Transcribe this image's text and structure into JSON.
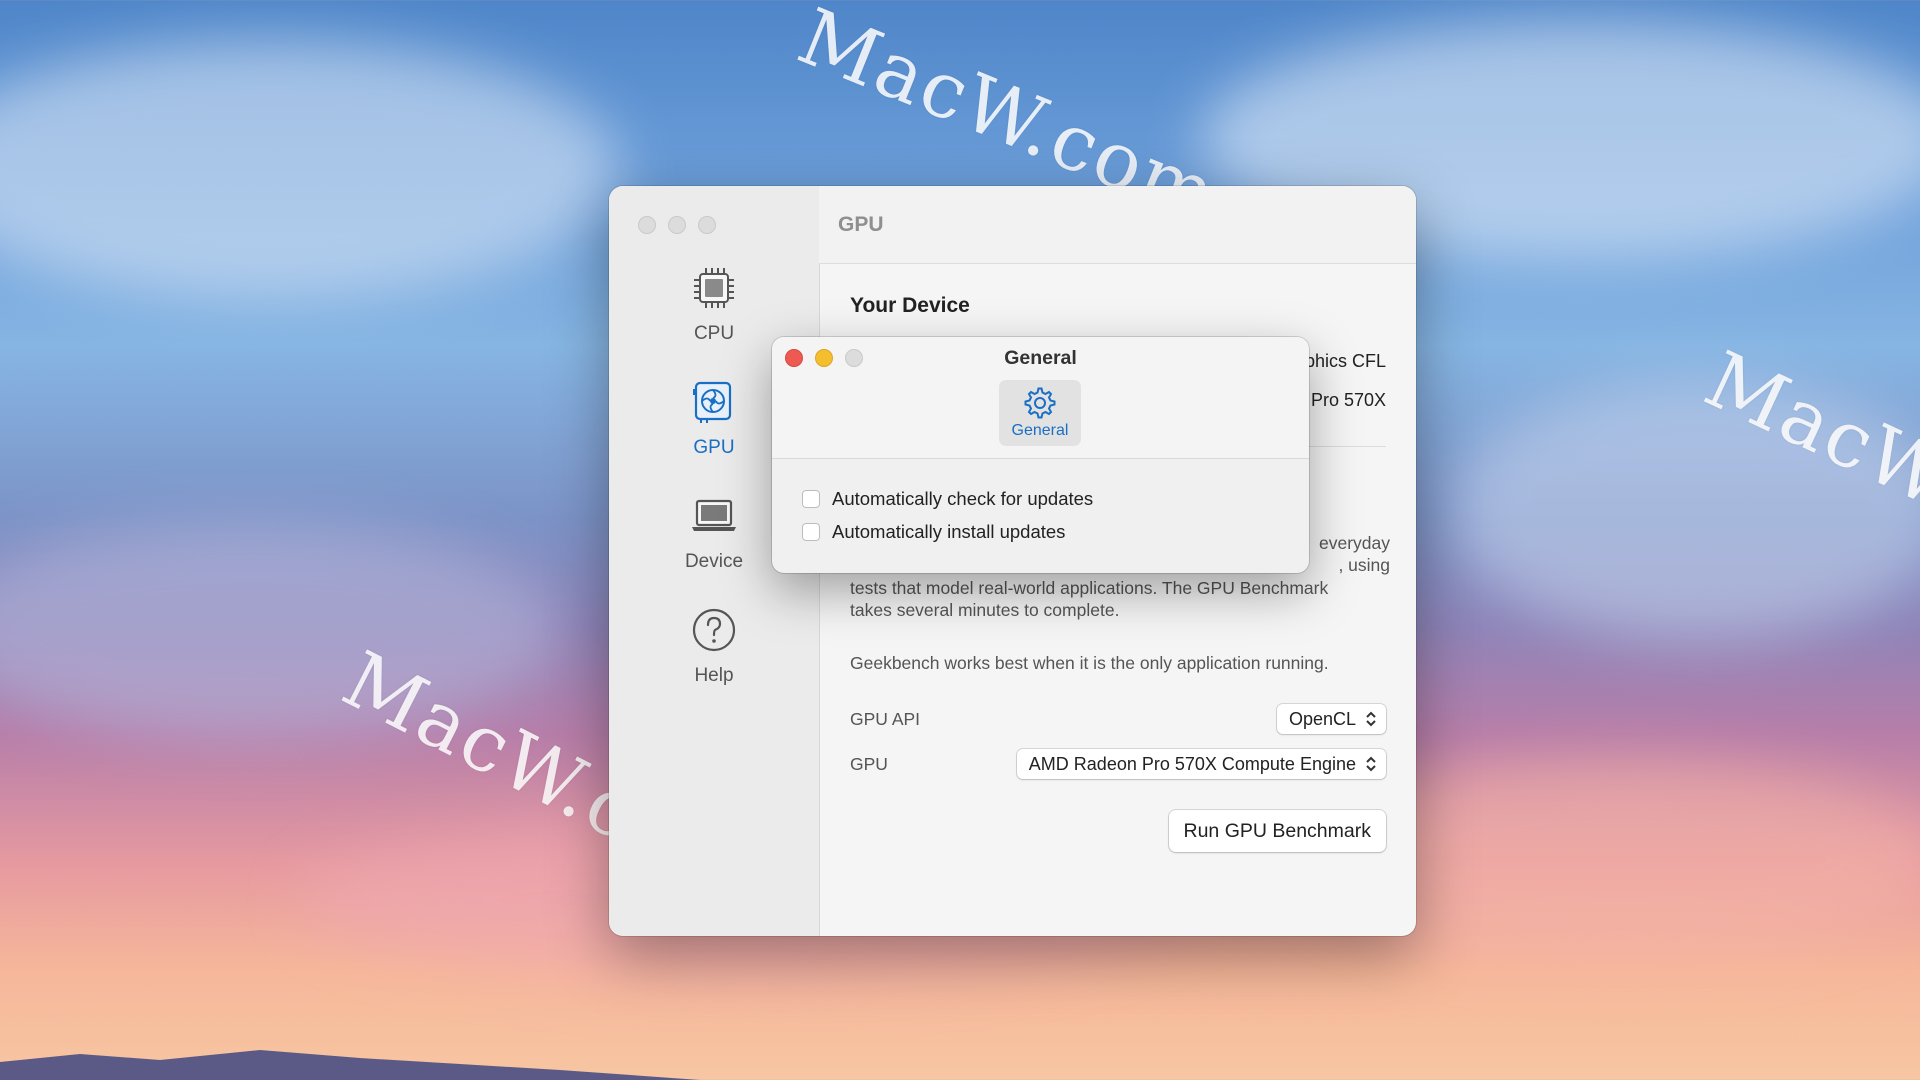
{
  "watermark": {
    "text": "MacW.com"
  },
  "window": {
    "header_title": "GPU",
    "sidebar": {
      "items": [
        {
          "label": "CPU",
          "icon": "cpu-chip-icon",
          "active": false
        },
        {
          "label": "GPU",
          "icon": "gpu-card-icon",
          "active": true
        },
        {
          "label": "Device",
          "icon": "laptop-icon",
          "active": false
        },
        {
          "label": "Help",
          "icon": "question-circle-icon",
          "active": false
        }
      ]
    },
    "device": {
      "section_title": "Your Device",
      "line1_visible_tail": "phics CFL",
      "line2_visible_tail": "Pro 570X"
    },
    "description": {
      "line1_tail": "everyday",
      "line2_tail": ", using",
      "line3": "tests that model real-world applications. The GPU Benchmark",
      "line4": "takes several minutes to complete."
    },
    "note": "Geekbench works best when it is the only application running.",
    "gpu_api": {
      "label": "GPU API",
      "value": "OpenCL"
    },
    "gpu": {
      "label": "GPU",
      "value": "AMD Radeon Pro 570X Compute Engine"
    },
    "run_button": "Run GPU Benchmark"
  },
  "preferences": {
    "title": "General",
    "tab_label": "General",
    "tab_icon": "gear-icon",
    "options": [
      {
        "label": "Automatically check for updates",
        "checked": false
      },
      {
        "label": "Automatically install updates",
        "checked": false
      }
    ]
  },
  "colors": {
    "accent": "#1a6fc4",
    "close": "#ee5a52",
    "minimize": "#f5be2f"
  }
}
